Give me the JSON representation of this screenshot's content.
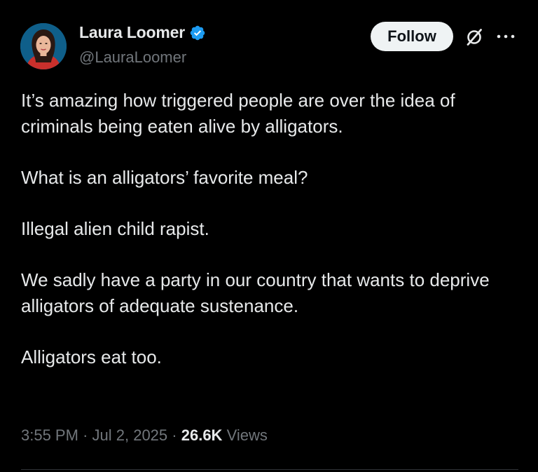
{
  "author": {
    "display_name": "Laura Loomer",
    "handle": "@LauraLoomer",
    "verified": true,
    "avatar_icon": "avatar-photo"
  },
  "actions": {
    "follow_label": "Follow",
    "grok_icon": "grok-icon",
    "more_icon": "more-horizontal-icon"
  },
  "tweet": {
    "paragraphs": [
      "It’s amazing how triggered people are over the idea of criminals being eaten alive by alligators.",
      "What is an alligators’ favorite meal?",
      "Illegal alien child rapist.",
      "We sadly have a party in our country that wants to deprive alligators of adequate sustenance.",
      "Alligators eat too."
    ]
  },
  "meta": {
    "time": "3:55 PM",
    "separator": "·",
    "date": "Jul 2, 2025",
    "views_count": "26.6K",
    "views_label": "Views"
  },
  "colors": {
    "background": "#000000",
    "text_primary": "#e7e9ea",
    "text_secondary": "#71767b",
    "verified_badge": "#1d9bf0",
    "follow_button_bg": "#eff3f4",
    "divider": "#2f3336"
  }
}
